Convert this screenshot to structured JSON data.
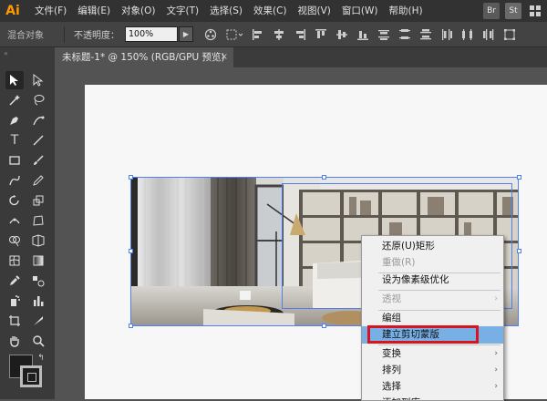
{
  "app": {
    "logo": "Ai"
  },
  "menubar": {
    "items": [
      "文件(F)",
      "编辑(E)",
      "对象(O)",
      "文字(T)",
      "选择(S)",
      "效果(C)",
      "视图(V)",
      "窗口(W)",
      "帮助(H)"
    ],
    "right_icons": [
      "Br",
      "St"
    ]
  },
  "control_bar": {
    "mode_label": "混合对象",
    "opacity_label": "不透明度：",
    "opacity_value": "100%"
  },
  "document": {
    "tab_title": "未标题-1* @ 150% (RGB/GPU 预览)",
    "close_glyph": "×"
  },
  "context_menu": {
    "items": [
      {
        "label": "还原(U)矩形",
        "disabled": false,
        "submenu": false
      },
      {
        "label": "重做(R)",
        "disabled": true,
        "submenu": false
      },
      {
        "label": "设为像素级优化",
        "disabled": false,
        "submenu": false
      },
      {
        "label": "透视",
        "disabled": true,
        "submenu": true
      },
      {
        "label": "编组",
        "disabled": false,
        "submenu": false
      },
      {
        "label": "建立剪切蒙版",
        "disabled": false,
        "submenu": false,
        "highlighted": true
      },
      {
        "label": "变换",
        "disabled": false,
        "submenu": true
      },
      {
        "label": "排列",
        "disabled": false,
        "submenu": true
      },
      {
        "label": "选择",
        "disabled": false,
        "submenu": true
      },
      {
        "label": "添加到库",
        "disabled": false,
        "submenu": false
      }
    ]
  },
  "colors": {
    "menubar_bg": "#323232",
    "panel_bg": "#434343",
    "highlight": "#78b0e6",
    "selection": "#4f7ff0",
    "annotation_red": "#d9141e",
    "logo": "#ff9a00"
  },
  "icons": {
    "tools": [
      "selection-tool",
      "direct-selection-tool",
      "magic-wand-tool",
      "lasso-tool",
      "pen-tool",
      "curvature-tool",
      "type-tool",
      "line-segment-tool",
      "rectangle-tool",
      "paintbrush-tool",
      "shaper-tool",
      "pencil-tool",
      "rotate-tool",
      "scale-tool",
      "width-tool",
      "free-transform-tool",
      "shape-builder-tool",
      "perspective-grid-tool",
      "mesh-tool",
      "gradient-tool",
      "eyedropper-tool",
      "blend-tool",
      "symbol-sprayer-tool",
      "column-graph-tool",
      "artboard-tool",
      "slice-tool",
      "hand-tool",
      "zoom-tool"
    ]
  }
}
